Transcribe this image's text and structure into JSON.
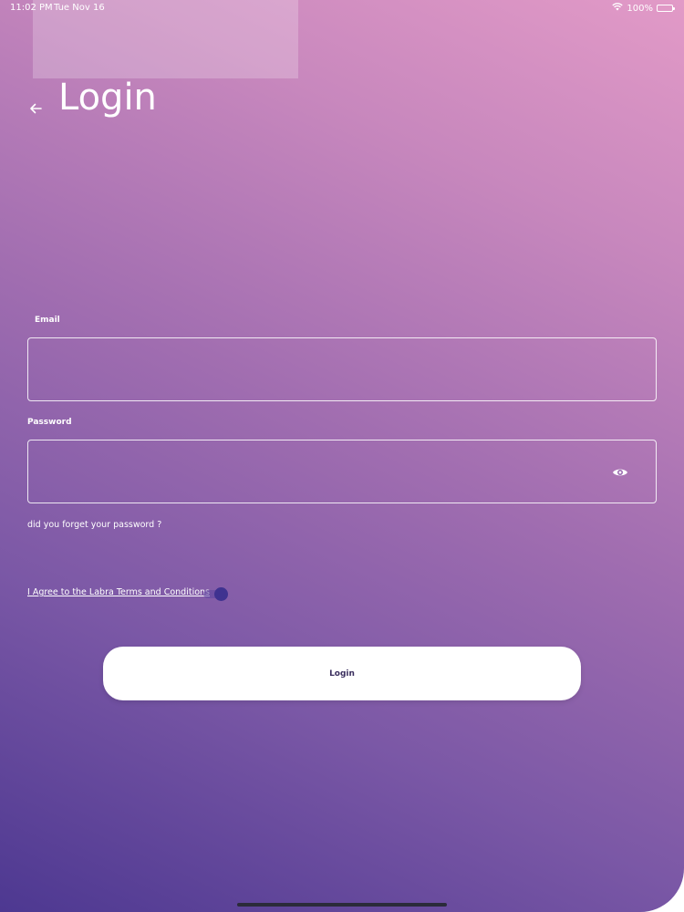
{
  "status_bar": {
    "time": "11:02 PM",
    "date": "Tue Nov 16",
    "battery_text": "100%",
    "wifi_icon": "wifi-icon",
    "battery_icon": "battery-icon",
    "battery_level": 1.0
  },
  "header": {
    "back_icon": "arrow-left-icon",
    "title": "Login"
  },
  "form": {
    "email": {
      "label": "Email",
      "value": "",
      "placeholder": ""
    },
    "password": {
      "label": "Password",
      "value": "",
      "placeholder": "",
      "toggle_icon": "eye-icon"
    },
    "forgot_password": "did you forget your password ?",
    "terms": {
      "label": "I Agree to the Labra Terms and Conditions",
      "accepted": true
    },
    "submit_label": "Login"
  },
  "colors": {
    "gradient_top_right": "#e29ac7",
    "gradient_bottom_left": "#4d3891",
    "toggle_knob": "#3f3290",
    "button_text": "#3a2e5e"
  }
}
